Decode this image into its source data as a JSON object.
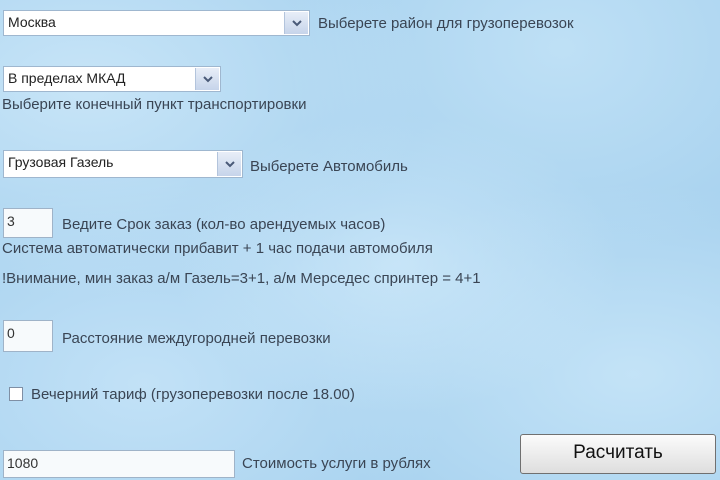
{
  "district": {
    "selected": "Москва",
    "label": "Выберете район для грузоперевозок"
  },
  "destination": {
    "selected": "В пределах МКАД",
    "label": "Выберите конечный пункт транспортировки"
  },
  "vehicle": {
    "selected": "Грузовая Газель",
    "label": "Выберете Автомобиль"
  },
  "hours": {
    "value": "3",
    "label": "Ведите Срок заказ (кол-во арендуемых часов)",
    "note_line1": "Система автоматически прибавит + 1 час подачи автомобиля",
    "note_line2": "!Внимание, мин заказ а/м Газель=3+1, а/м Мерседес спринтер = 4+1"
  },
  "distance": {
    "value": "0",
    "label": "Расстояние междугородней перевозки"
  },
  "evening_tariff": {
    "checked": false,
    "label": "Вечерний тариф (грузоперевозки после 18.00)"
  },
  "cost": {
    "value": "1080",
    "label": "Стоимость услуги в рублях",
    "button_label": "Расчитать"
  },
  "icons": {
    "dropdown": "chevron-down-icon",
    "checkbox": "checkbox-unchecked-icon"
  },
  "colors": {
    "background": "#a8d2ef",
    "text": "#3a4554",
    "dropdown_button": "#c6d4ea"
  }
}
